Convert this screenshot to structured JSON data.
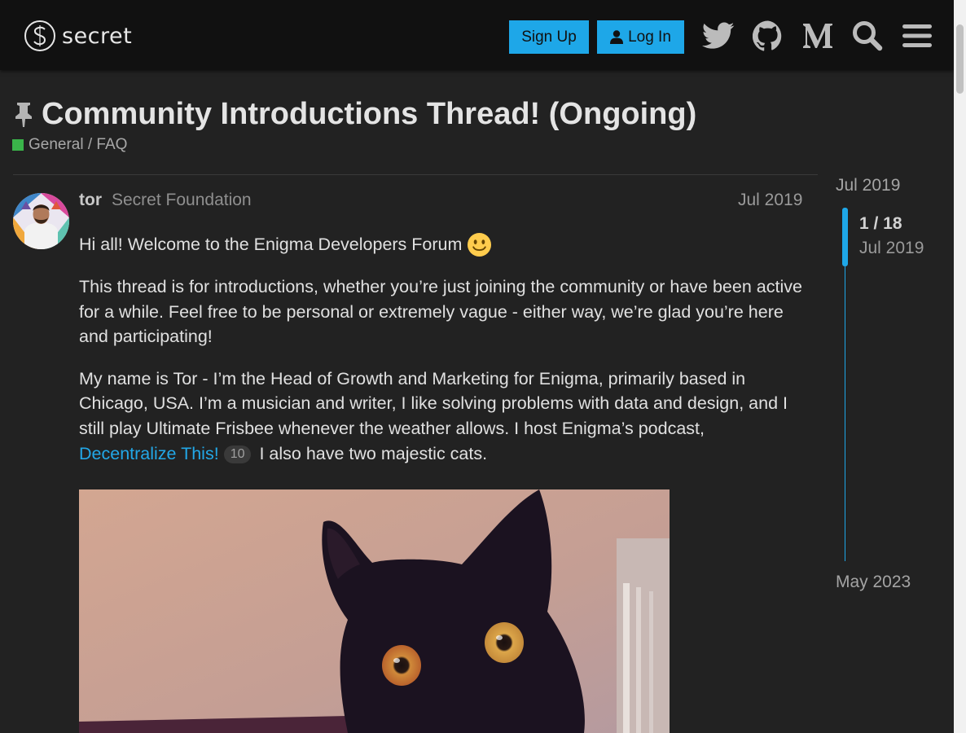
{
  "header": {
    "logo_text": "secret",
    "signup_label": "Sign Up",
    "login_label": "Log In",
    "icons": [
      "twitter-icon",
      "github-icon",
      "medium-icon",
      "search-icon",
      "hamburger-menu-icon"
    ]
  },
  "topic": {
    "title": "Community Introductions Thread! (Ongoing)",
    "category": "General / FAQ",
    "category_color": "#3ab54a"
  },
  "post": {
    "username": "tor",
    "user_title": "Secret Foundation",
    "date": "Jul 2019",
    "p1": "Hi all! Welcome to the Enigma Developers Forum",
    "p2": "This thread is for introductions, whether you’re just joining the community or have been active for a while. Feel free to be personal or extremely vague - either way, we’re glad you’re here and participating!",
    "p3_text": "My name is Tor - I’m the Head of Growth and Marketing for Enigma, primarily based in Chicago, USA. I’m a musician and writer, I like solving problems with data and design, and I still play Ultimate Frisbee whenever the weather allows. I host Enigma’s podcast,",
    "p3_link": "Decentralize This!",
    "p3_link_clicks": "10",
    "p3_tail": "I also have two majestic cats."
  },
  "timeline": {
    "start": "Jul 2019",
    "position": "1 / 18",
    "current_date": "Jul 2019",
    "end": "May 2023"
  },
  "colors": {
    "accent": "#1ea7e8",
    "background": "#222222",
    "header_bg": "#111111"
  }
}
